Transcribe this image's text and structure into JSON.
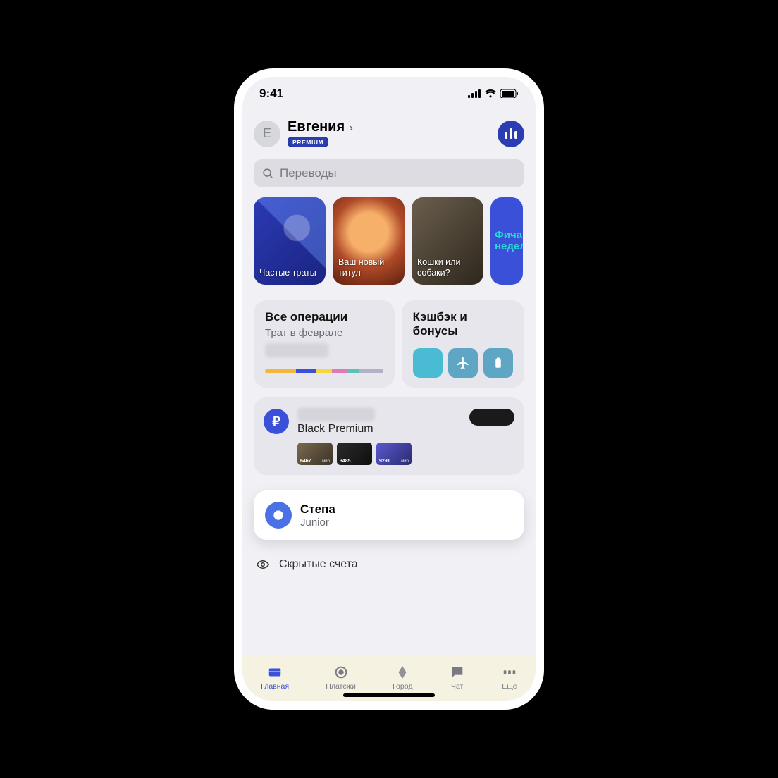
{
  "status": {
    "time": "9:41"
  },
  "header": {
    "avatar_initial": "Е",
    "name": "Евгения",
    "badge": "PREMIUM"
  },
  "search": {
    "placeholder": "Переводы"
  },
  "stories": [
    {
      "label": "Частые траты"
    },
    {
      "label": "Ваш новый титул"
    },
    {
      "label": "Кошки или собаки?"
    },
    {
      "partial_text": "Фича\nнедел"
    }
  ],
  "operations": {
    "title": "Все операции",
    "subtitle": "Трат в феврале"
  },
  "cashback": {
    "title": "Кэшбэк и бонусы"
  },
  "main_account": {
    "name": "Black Premium",
    "cards": [
      {
        "last4": "6467",
        "system": "мир"
      },
      {
        "last4": "3485",
        "system": ""
      },
      {
        "last4": "9291",
        "system": "мир"
      }
    ]
  },
  "junior": {
    "name": "Степа",
    "subtitle": "Junior"
  },
  "hidden_accounts": {
    "label": "Скрытые счета"
  },
  "tabs": {
    "home": "Главная",
    "payments": "Платежи",
    "city": "Город",
    "chat": "Чат",
    "more": "Еще"
  }
}
